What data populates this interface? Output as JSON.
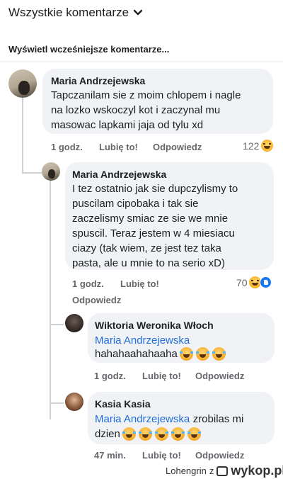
{
  "header": {
    "title": "Wszystkie komentarze",
    "chevron": "chevron-down-icon"
  },
  "previous_comments": "Wyświetl wcześniejsze komentarze...",
  "comments": [
    {
      "author": "Maria Andrzejewska",
      "text": "Tapczanilam sie z moim chlopem i nagle\nna lozko wskoczyl kot i zaczynal mu\nmasowac lapkami jaja od tylu xd",
      "time": "1 godz.",
      "like": "Lubię to!",
      "reply": "Odpowiedz",
      "reactions": "122"
    },
    {
      "author": "Maria Andrzejewska",
      "text": "I tez ostatnio jak sie dupczylismy to\npuscilam cipobaka i tak sie\nzaczelismy smiac ze sie we mnie\nspuscil. Teraz jestem w 4 miesiacu\nciazy (tak wiem, ze jest tez taka\npasta, ale u mnie to na serio xD)",
      "time": "1 godz.",
      "like": "Lubię to!",
      "reply": "Odpowiedz",
      "reactions": "70"
    },
    {
      "author": "Wiktoria Weronika Włoch",
      "mention": "Maria Andrzejewska",
      "text": "hahahaahahaaha",
      "time": "1 godz.",
      "like": "Lubię to!",
      "reply": "Odpowiedz"
    },
    {
      "author": "Kasia Kasia",
      "mention": "Maria Andrzejewska",
      "text_after": "zrobilas mi",
      "text_line2": "dzien",
      "time": "47 min.",
      "like": "Lubię to!",
      "reply": "Odpowiedz"
    }
  ],
  "watermark": {
    "user": "Lohengrin",
    "z": "z",
    "site": "wykop.pl"
  },
  "colors": {
    "bubble": "#f0f2f5",
    "mention": "#216fdb",
    "meta": "#65676b",
    "like": "#1877f2"
  }
}
